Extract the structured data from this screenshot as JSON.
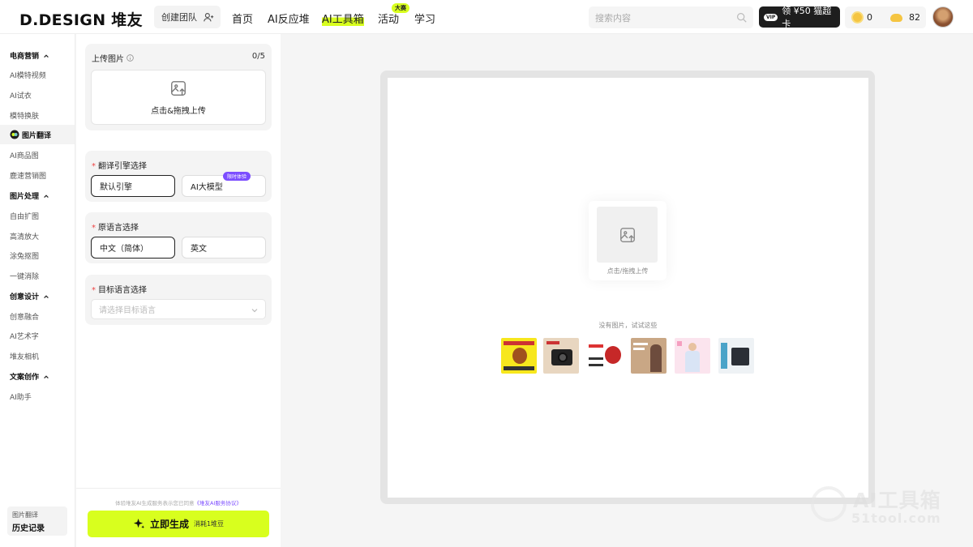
{
  "header": {
    "logo": "D.DESIGN 堆友",
    "team_button": "创建团队",
    "nav": [
      "首页",
      "AI反应堆",
      "AI工具箱",
      "活动",
      "学习"
    ],
    "nav_badge": "大赛",
    "search_placeholder": "搜索内容",
    "vip_tag": "VIP",
    "vip_label": "领 ¥50 猫超卡",
    "coin_count": "0",
    "bean_count": "82"
  },
  "sidebar": {
    "groups": [
      {
        "title": "电商营销",
        "items": [
          "AI模特视频",
          "AI试衣",
          "模特换肤",
          "图片翻译",
          "AI商品图",
          "鹿速营销图"
        ]
      },
      {
        "title": "图片处理",
        "items": [
          "自由扩图",
          "高清放大",
          "涂兔抠图",
          "一键消除"
        ]
      },
      {
        "title": "创意设计",
        "items": [
          "创意融合",
          "AI艺术字",
          "堆友相机"
        ]
      },
      {
        "title": "文案创作",
        "items": [
          "AI助手"
        ]
      }
    ],
    "history_sub": "图片翻译",
    "history_main": "历史记录"
  },
  "panel": {
    "upload_title": "上传图片",
    "upload_count": "0/5",
    "upload_hint": "点击&拖拽上传",
    "engine_title": "翻译引擎选择",
    "engine_options": [
      "默认引擎",
      "AI大模型"
    ],
    "engine_tag": "限时体验",
    "source_title": "原语言选择",
    "source_options": [
      "中文（简体）",
      "英文"
    ],
    "target_title": "目标语言选择",
    "target_placeholder": "请选择目标语言",
    "agree_text": "体验堆友AI生成服务表示您已同意",
    "agree_link": "《堆友AI服务协议》",
    "generate_label": "立即生成",
    "generate_cost": "消耗1堆豆"
  },
  "canvas": {
    "drop_label": "点击/拖拽上传",
    "try_label": "没有图片，试试这些"
  },
  "watermark": {
    "big": "AI工具箱",
    "small": "51tool.com"
  }
}
